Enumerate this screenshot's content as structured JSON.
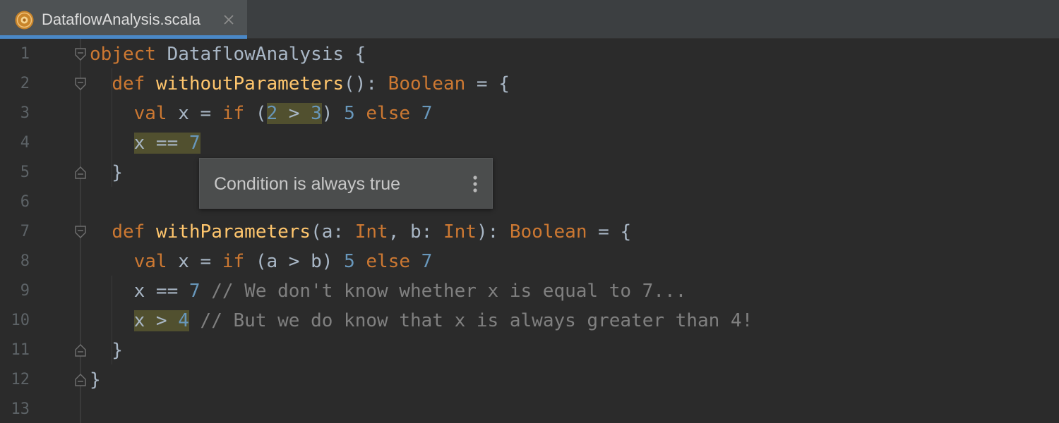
{
  "tab": {
    "filename": "DataflowAnalysis.scala",
    "icon": "scala-file-icon",
    "accent": "#4a88c7"
  },
  "tooltip": {
    "message": "Condition is always true",
    "menu_icon": "more-vertical-icon"
  },
  "colors": {
    "background": "#2b2b2b",
    "keyword": "#cc7832",
    "function": "#ffc66d",
    "number": "#6897bb",
    "comment": "#808080",
    "text": "#a9b7c6",
    "highlight": "#51502f"
  },
  "lines": [
    {
      "number": "1",
      "fold": "fold-open",
      "tokens": [
        {
          "t": "object",
          "k": "kw"
        },
        {
          "t": " DataflowAnalysis {",
          "k": "pl"
        }
      ]
    },
    {
      "number": "2",
      "fold": "fold-open",
      "tokens": [
        {
          "t": "  ",
          "k": "pl"
        },
        {
          "t": "def",
          "k": "kw"
        },
        {
          "t": " ",
          "k": "pl"
        },
        {
          "t": "withoutParameters",
          "k": "fn"
        },
        {
          "t": "(): ",
          "k": "pl"
        },
        {
          "t": "Boolean",
          "k": "kw"
        },
        {
          "t": " = {",
          "k": "pl"
        }
      ]
    },
    {
      "number": "3",
      "fold": "none",
      "tokens": [
        {
          "t": "    ",
          "k": "pl"
        },
        {
          "t": "val",
          "k": "kw"
        },
        {
          "t": " x = ",
          "k": "pl"
        },
        {
          "t": "if",
          "k": "kw"
        },
        {
          "t": " (",
          "k": "pl"
        },
        {
          "t": "2",
          "k": "num",
          "hl": true
        },
        {
          "t": " > ",
          "k": "pl",
          "hl": true
        },
        {
          "t": "3",
          "k": "num",
          "hl": true
        },
        {
          "t": ") ",
          "k": "pl"
        },
        {
          "t": "5",
          "k": "num"
        },
        {
          "t": " ",
          "k": "pl"
        },
        {
          "t": "else",
          "k": "kw"
        },
        {
          "t": " ",
          "k": "pl"
        },
        {
          "t": "7",
          "k": "num"
        }
      ]
    },
    {
      "number": "4",
      "fold": "none",
      "tokens": [
        {
          "t": "    ",
          "k": "pl"
        },
        {
          "t": "x == ",
          "k": "pl",
          "hl": true
        },
        {
          "t": "7",
          "k": "num",
          "hl": true
        }
      ]
    },
    {
      "number": "5",
      "fold": "fold-close",
      "tokens": [
        {
          "t": "  }",
          "k": "pl"
        }
      ]
    },
    {
      "number": "6",
      "fold": "none",
      "tokens": []
    },
    {
      "number": "7",
      "fold": "fold-open",
      "tokens": [
        {
          "t": "  ",
          "k": "pl"
        },
        {
          "t": "def",
          "k": "kw"
        },
        {
          "t": " ",
          "k": "pl"
        },
        {
          "t": "withParameters",
          "k": "fn"
        },
        {
          "t": "(a: ",
          "k": "pl"
        },
        {
          "t": "Int",
          "k": "kw"
        },
        {
          "t": ", b: ",
          "k": "pl"
        },
        {
          "t": "Int",
          "k": "kw"
        },
        {
          "t": "): ",
          "k": "pl"
        },
        {
          "t": "Boolean",
          "k": "kw"
        },
        {
          "t": " = {",
          "k": "pl"
        }
      ]
    },
    {
      "number": "8",
      "fold": "none",
      "tokens": [
        {
          "t": "    ",
          "k": "pl"
        },
        {
          "t": "val",
          "k": "kw"
        },
        {
          "t": " x = ",
          "k": "pl"
        },
        {
          "t": "if",
          "k": "kw"
        },
        {
          "t": " (a > b) ",
          "k": "pl"
        },
        {
          "t": "5",
          "k": "num"
        },
        {
          "t": " ",
          "k": "pl"
        },
        {
          "t": "else",
          "k": "kw"
        },
        {
          "t": " ",
          "k": "pl"
        },
        {
          "t": "7",
          "k": "num"
        }
      ]
    },
    {
      "number": "9",
      "fold": "none",
      "tokens": [
        {
          "t": "    x == ",
          "k": "pl"
        },
        {
          "t": "7",
          "k": "num"
        },
        {
          "t": " // We don't know whether x is equal to 7...",
          "k": "cmt"
        }
      ]
    },
    {
      "number": "10",
      "fold": "none",
      "tokens": [
        {
          "t": "    ",
          "k": "pl"
        },
        {
          "t": "x > ",
          "k": "pl",
          "hl": true
        },
        {
          "t": "4",
          "k": "num",
          "hl": true
        },
        {
          "t": " // But we do know that x is always greater than 4!",
          "k": "cmt"
        }
      ]
    },
    {
      "number": "11",
      "fold": "fold-close",
      "tokens": [
        {
          "t": "  }",
          "k": "pl"
        }
      ]
    },
    {
      "number": "12",
      "fold": "fold-close",
      "tokens": [
        {
          "t": "}",
          "k": "pl"
        }
      ]
    },
    {
      "number": "13",
      "fold": "none",
      "tokens": []
    }
  ]
}
